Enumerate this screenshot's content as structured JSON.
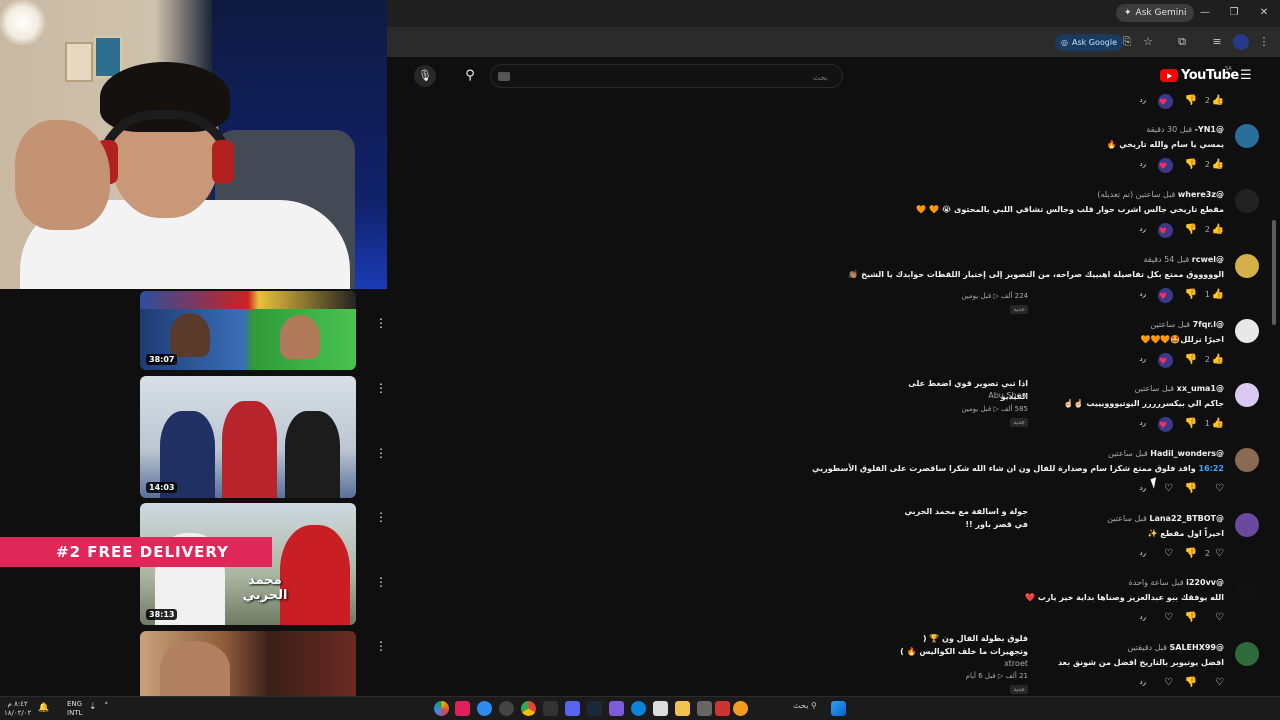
{
  "browser": {
    "gemini_label": "Ask Gemini",
    "ask_google_label": "Ask Google"
  },
  "youtube": {
    "logo_text": "YouTube",
    "region": "SA",
    "search_placeholder": "بحث"
  },
  "sidebar_videos": [
    {
      "views": "224 ألف",
      "age": "قبل يومين",
      "badge": "جديد",
      "duration": "38:07"
    },
    {
      "title": "اذا تبي تصوير قوي اضغط على الفيديو",
      "channel": "Abu Show",
      "views": "585 ألف",
      "age": "قبل يومين",
      "badge": "جديد",
      "duration": "14:03"
    },
    {
      "title": "جولة و اسالفة مع محمد الحربي في قصر باور !!",
      "duration": "38:13"
    },
    {
      "title": "فلوق بطولة الفال ون 🏆 ( وتجهيزات ما خلف الكواليس 🔥 )",
      "channel": "xtroet",
      "views": "21 ألف",
      "age": "قبل 6 أيام",
      "badge": "جديد"
    }
  ],
  "promo_banner": "#2 FREE DELIVERY",
  "comments": [
    {
      "user": "",
      "time": "",
      "text": "",
      "likes": "2"
    },
    {
      "user": "@YN1-",
      "time": "قبل 30 دقيقة",
      "text": "يمسي يا سام والله تاريخي 🔥",
      "likes": "2"
    },
    {
      "user": "@where3z",
      "time": "قبل ساعتين (تم تعديله)",
      "text": "مقطع تاريخي جالس اشرب حوار قلب وجالس تشاقي اللبي بالمحتوى 😭 🧡 🧡",
      "likes": "2"
    },
    {
      "user": "@rcwel",
      "time": "قبل 54 دقيقة",
      "text": "الوووووق ممتع بكل تفاصيله اهبييك صراحه، من التصوير إلى إختيار اللقطات حوابدك يا الشيخ 👏🏽",
      "likes": "1"
    },
    {
      "user": "@7fqr.l",
      "time": "قبل ساعتين",
      "text": "اخيرًا نزللل🤩🧡🧡🧡",
      "likes": "2"
    },
    {
      "user": "@xx_uma1",
      "time": "قبل ساعتين",
      "text": "جاكم الي بيكسررررر اليوتيووويييب ☝🏻☝🏻",
      "likes": "1"
    },
    {
      "user": "@Hadil_wonders",
      "time": "قبل ساعتين",
      "timestamp": "16:22",
      "text": "واقد فلوق ممتع شكرا سام وصدارة للفال ون ان شاء الله شكرا ساقصرت على الفلوق الأسطوريي",
      "likes": ""
    },
    {
      "user": "@Lana22_BTBOT",
      "time": "قبل ساعتين",
      "text": "اخيراً اول مقطع ✨",
      "likes": "2"
    },
    {
      "user": "@i220vv",
      "time": "قبل ساعة واحدة",
      "text": "الله يوفقك ببو عبدالعزيز وصناها بداية خير يارب ❤️",
      "likes": ""
    },
    {
      "user": "@SALEHX99",
      "time": "قبل دقيقتين",
      "text": "افضل يوتيوبر بالتاريخ افضل من شونق بعد",
      "likes": ""
    }
  ],
  "reply_label": "رد",
  "taskbar": {
    "time": "٨:٤٢ م",
    "date": "١٨/٠٢/٠٢",
    "lang_top": "ENG",
    "lang_bottom": "INTL",
    "search_label": "بحث"
  },
  "colors": {
    "background": "#0f0f0f",
    "accent_red": "#ff0000",
    "link_blue": "#3ea6ff",
    "promo": "#e02759"
  }
}
